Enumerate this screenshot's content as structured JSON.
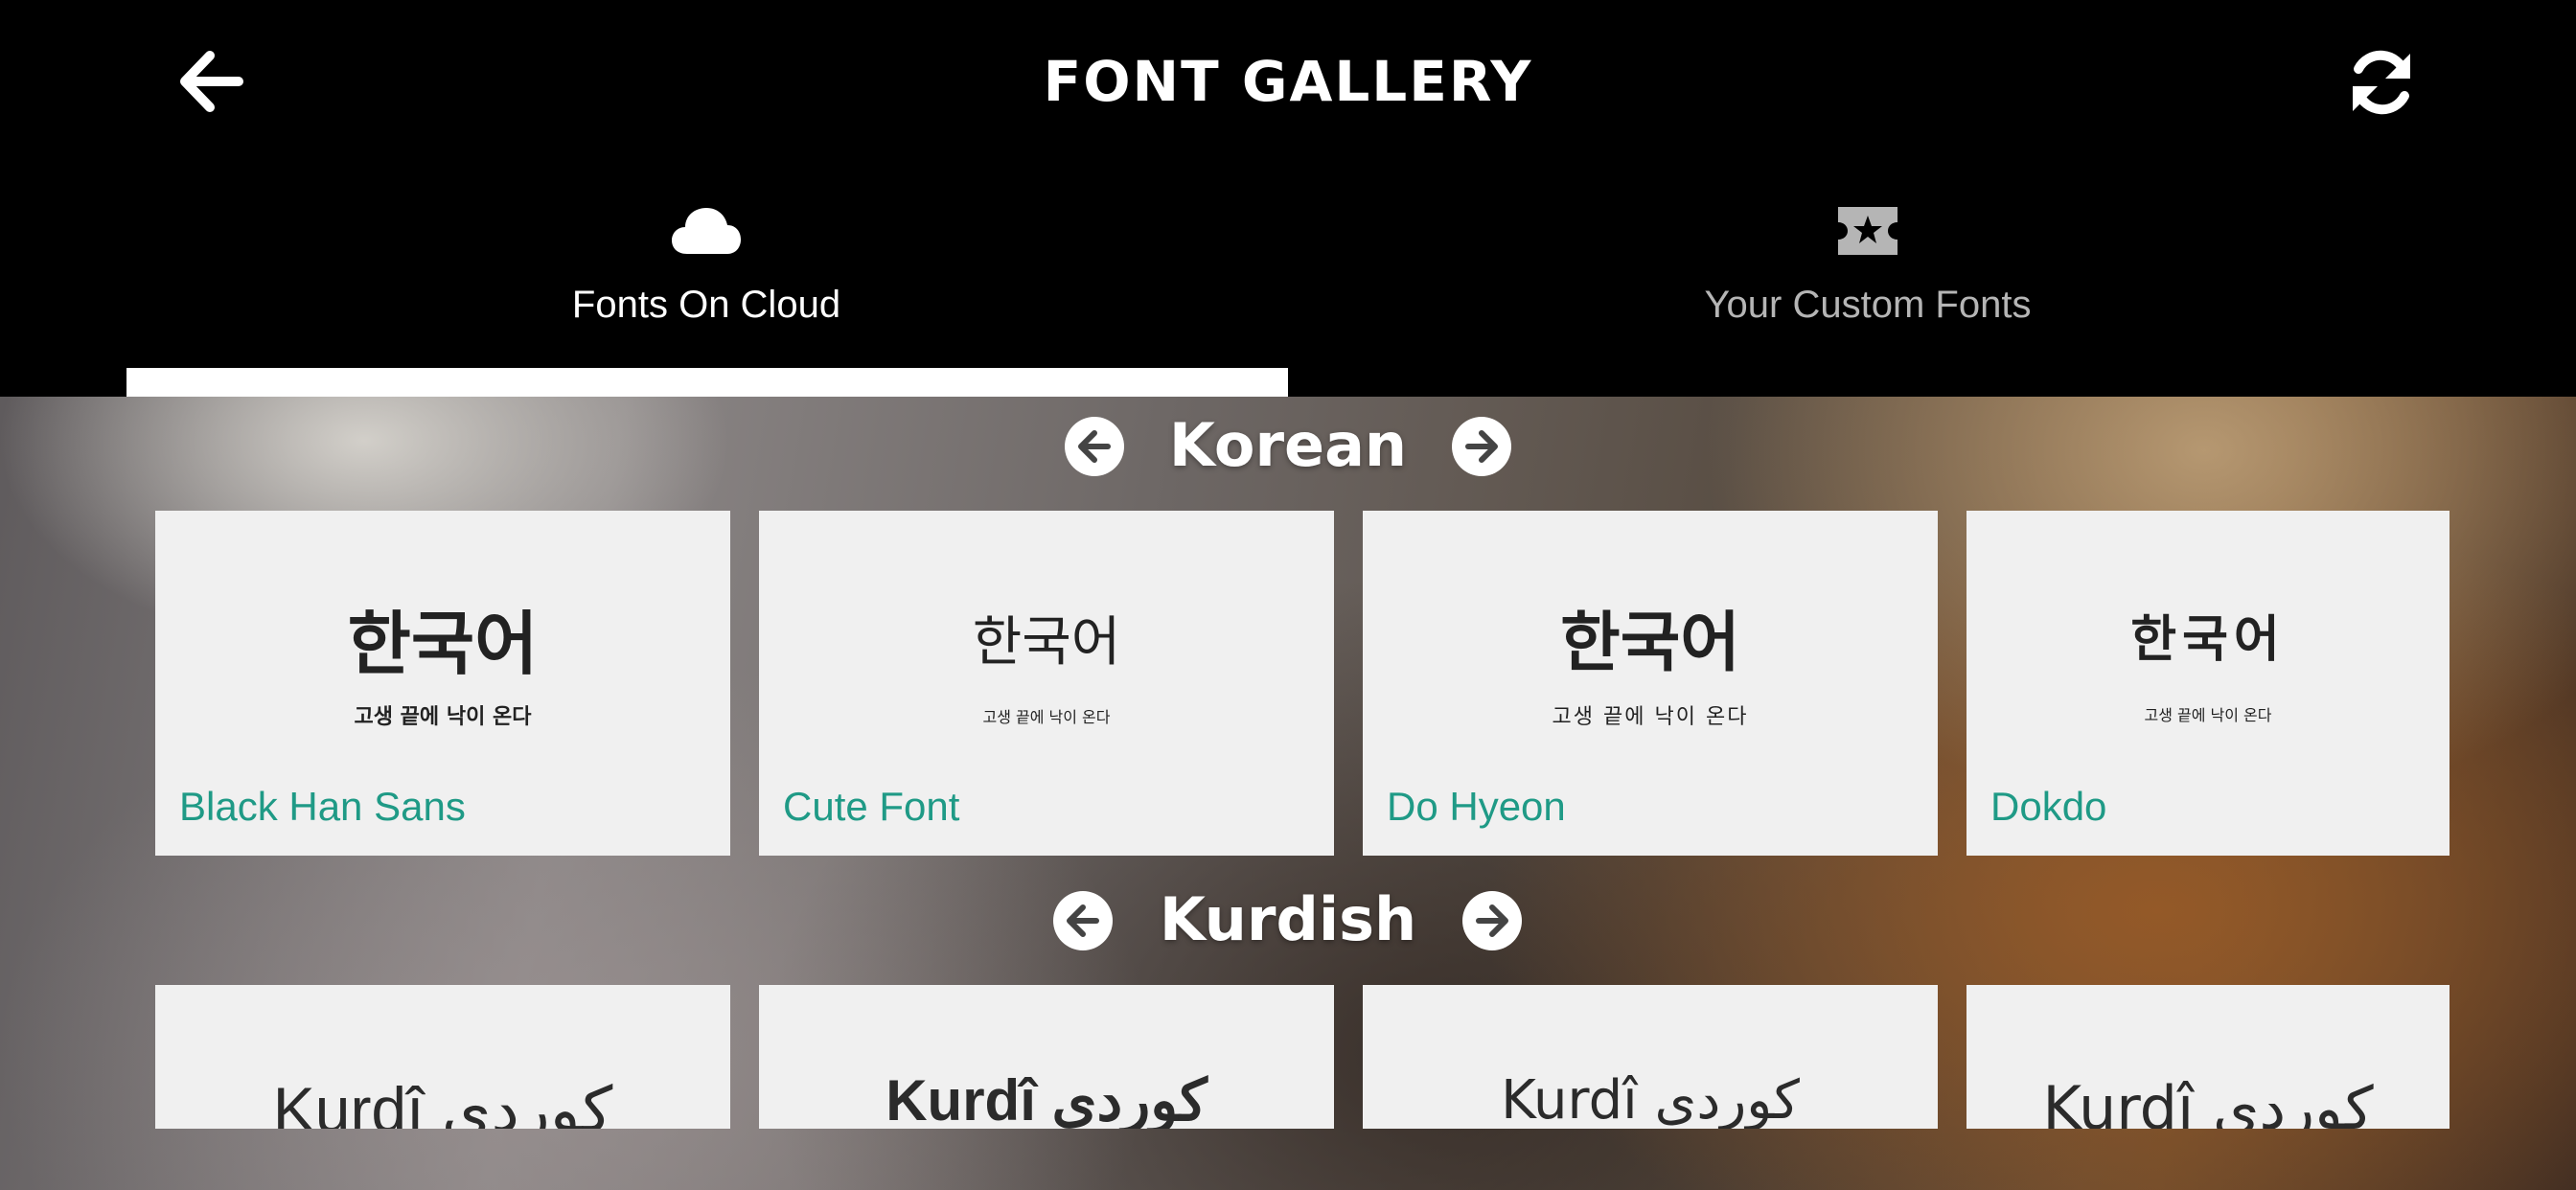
{
  "header": {
    "title": "FONT GALLERY",
    "back_icon": "arrow-left-icon",
    "refresh_icon": "refresh-icon"
  },
  "tabs": [
    {
      "label": "Fonts On Cloud",
      "icon": "cloud-icon",
      "selected": true
    },
    {
      "label": "Your Custom Fonts",
      "icon": "ticket-star-icon",
      "selected": false
    }
  ],
  "sections": [
    {
      "title": "Korean",
      "cards": [
        {
          "sample_big": "한국어",
          "sample_small": "고생 끝에 낙이 온다",
          "name": "Black Han Sans"
        },
        {
          "sample_big": "한국어",
          "sample_small": "고생 끝에 낙이 온다",
          "name": "Cute Font"
        },
        {
          "sample_big": "한국어",
          "sample_small": "고생 끝에 낙이 온다",
          "name": "Do Hyeon"
        },
        {
          "sample_big": "한국어",
          "sample_small": "고생 끝에 낙이 온다",
          "name": "Dokdo"
        }
      ]
    },
    {
      "title": "Kurdish",
      "cards": [
        {
          "sample": "Kurdî كوردى"
        },
        {
          "sample": "Kurdî كوردى"
        },
        {
          "sample": "Kurdî كوردى"
        },
        {
          "sample": "Kurdî كوردى"
        }
      ]
    }
  ],
  "colors": {
    "header_bg": "#000000",
    "font_name": "#1f9a86",
    "card_bg": "#f0f0f0"
  }
}
